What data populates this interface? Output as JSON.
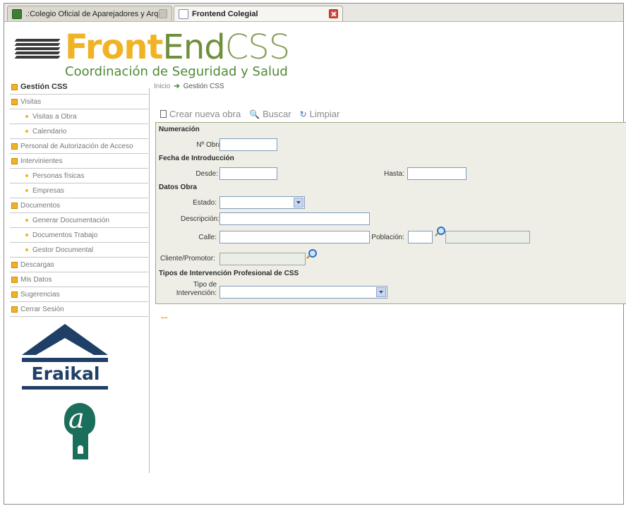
{
  "browser": {
    "tabs": [
      {
        "label": ".:Colegio Oficial de Aparejadores y Arq...",
        "active": false
      },
      {
        "label": "Frontend Colegial",
        "active": true
      }
    ]
  },
  "logo": {
    "brand_front": "Front",
    "brand_end": "End",
    "brand_css": "CSS",
    "subtitle": "Coordinación de Seguridad y Salud"
  },
  "sidebar": {
    "items": [
      {
        "label": "Gestión CSS",
        "type": "main",
        "active": true
      },
      {
        "label": "Visitas",
        "type": "main"
      },
      {
        "label": "Visitas a Obra",
        "type": "sub"
      },
      {
        "label": "Calendario",
        "type": "sub"
      },
      {
        "label": "Personal de Autorización de Acceso",
        "type": "main"
      },
      {
        "label": "Intervinientes",
        "type": "main"
      },
      {
        "label": "Personas físicas",
        "type": "sub"
      },
      {
        "label": "Empresas",
        "type": "sub"
      },
      {
        "label": "Documentos",
        "type": "main"
      },
      {
        "label": "Generar Documentación",
        "type": "sub"
      },
      {
        "label": "Documentos Trabajo",
        "type": "sub"
      },
      {
        "label": "Gestor Documental",
        "type": "sub"
      },
      {
        "label": "Descargas",
        "type": "main"
      },
      {
        "label": "Mis Datos",
        "type": "main"
      },
      {
        "label": "Sugerencias",
        "type": "main"
      },
      {
        "label": "Cerrar Sesión",
        "type": "main"
      }
    ]
  },
  "eraikal": {
    "name": "Eraikal"
  },
  "breadcrumb": {
    "home": "Inicio",
    "arrow": "➔",
    "current": "Gestión CSS"
  },
  "actions": {
    "new": "Crear nueva obra",
    "search": "Buscar",
    "clear": "Limpiar"
  },
  "form": {
    "sec_numeracion": "Numeración",
    "label_nobra": "Nº Obra:",
    "value_nobra": "",
    "sec_fecha": "Fecha de Introducción",
    "label_desde": "Desde:",
    "value_desde": "",
    "label_hasta": "Hasta:",
    "value_hasta": "",
    "sec_datos": "Datos Obra",
    "label_estado": "Estado:",
    "value_estado": "",
    "label_descripcion": "Descripción:",
    "value_descripcion": "",
    "label_calle": "Calle:",
    "value_calle": "",
    "label_poblacion": "Población:",
    "value_poblacion": "",
    "label_cliente": "Cliente/Promotor:",
    "value_cliente": "",
    "sec_tipos": "Tipos de Intervención Profesional de CSS",
    "label_tipo_1": "Tipo de",
    "label_tipo_2": "Intervención:",
    "value_tipo": ""
  },
  "footer": {
    "marker": "\"\""
  }
}
